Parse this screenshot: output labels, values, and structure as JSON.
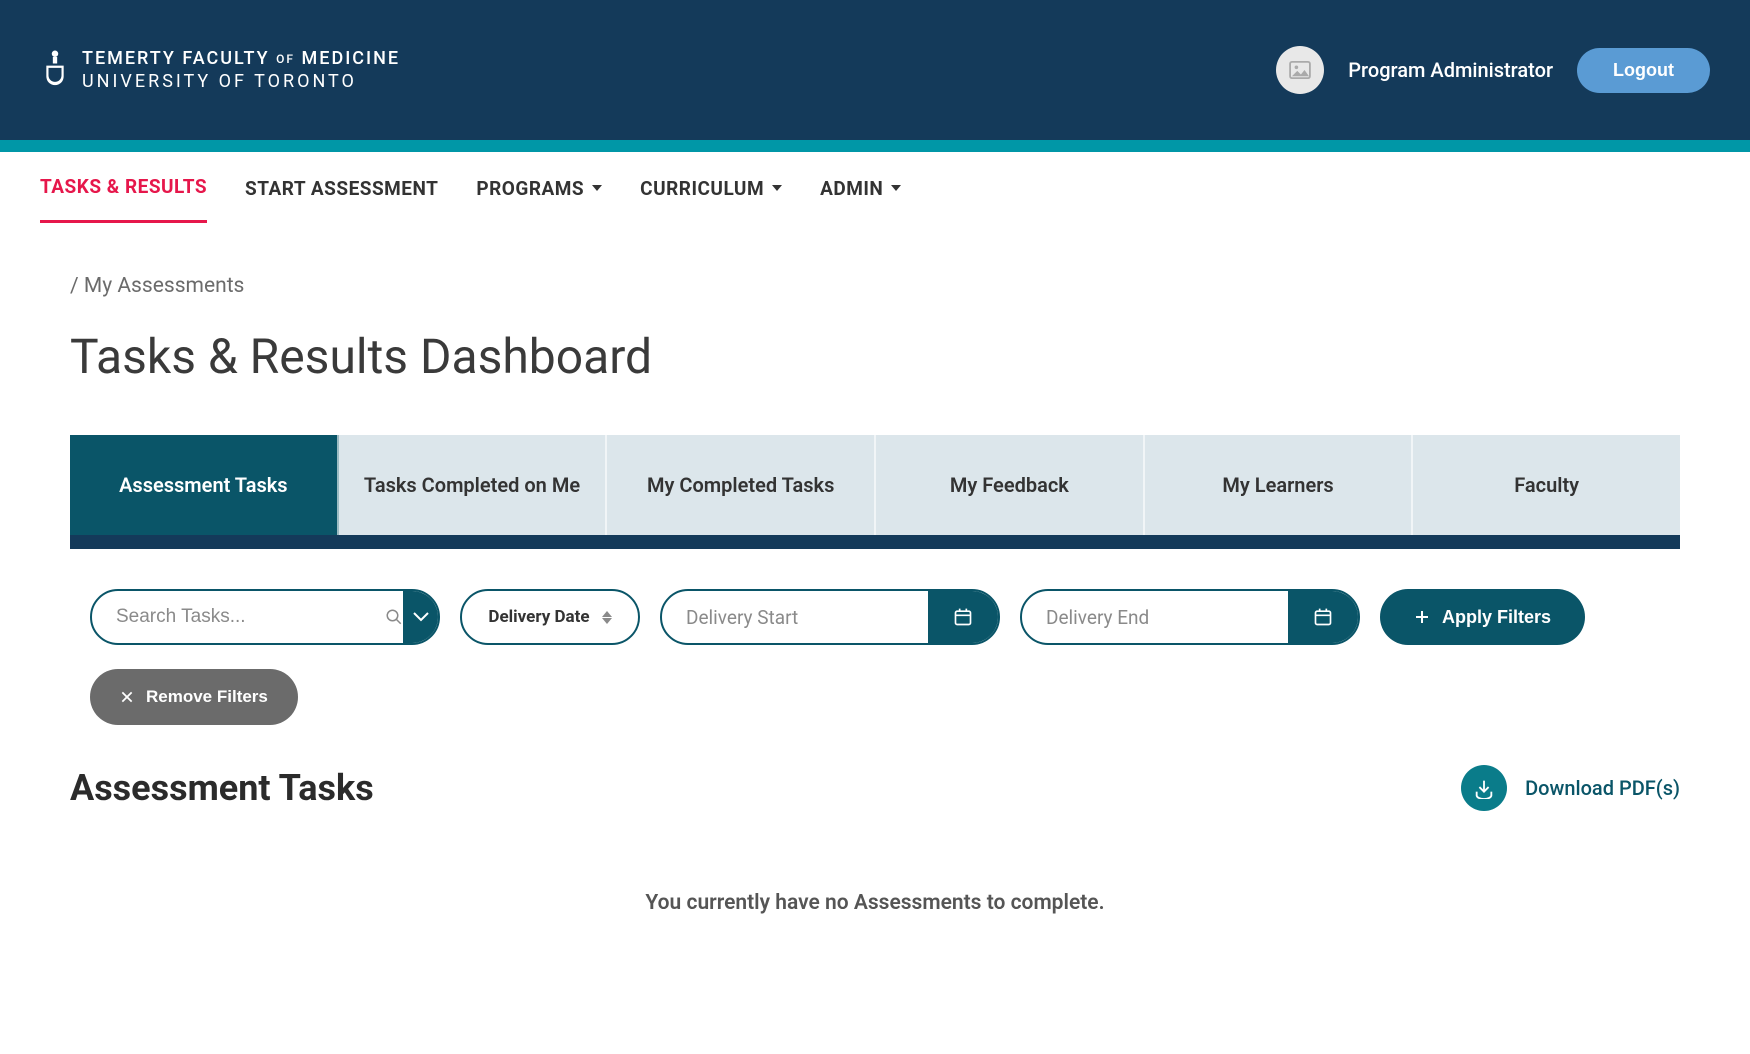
{
  "header": {
    "logo_line1_a": "TEMERTY FACULTY",
    "logo_of": "OF",
    "logo_line1_b": "MEDICINE",
    "logo_line2": "UNIVERSITY OF TORONTO",
    "user_name": "Program Administrator",
    "logout_label": "Logout"
  },
  "nav": {
    "items": [
      {
        "label": "TASKS & RESULTS",
        "active": true,
        "dropdown": false
      },
      {
        "label": "START ASSESSMENT",
        "active": false,
        "dropdown": false
      },
      {
        "label": "PROGRAMS",
        "active": false,
        "dropdown": true
      },
      {
        "label": "CURRICULUM",
        "active": false,
        "dropdown": true
      },
      {
        "label": "ADMIN",
        "active": false,
        "dropdown": true
      }
    ]
  },
  "breadcrumb": "/  My Assessments",
  "page_title": "Tasks & Results Dashboard",
  "tabs": [
    {
      "label": "Assessment Tasks",
      "active": true
    },
    {
      "label": "Tasks Completed on Me",
      "active": false
    },
    {
      "label": "My Completed Tasks",
      "active": false
    },
    {
      "label": "My Feedback",
      "active": false
    },
    {
      "label": "My Learners",
      "active": false
    },
    {
      "label": "Faculty",
      "active": false
    }
  ],
  "filters": {
    "search_placeholder": "Search Tasks...",
    "delivery_date_label": "Delivery Date",
    "delivery_start_placeholder": "Delivery Start",
    "delivery_end_placeholder": "Delivery End",
    "apply_label": "Apply Filters",
    "remove_label": "Remove Filters"
  },
  "section": {
    "title": "Assessment Tasks",
    "download_label": "Download PDF(s)",
    "empty_message": "You currently have no Assessments to complete."
  }
}
